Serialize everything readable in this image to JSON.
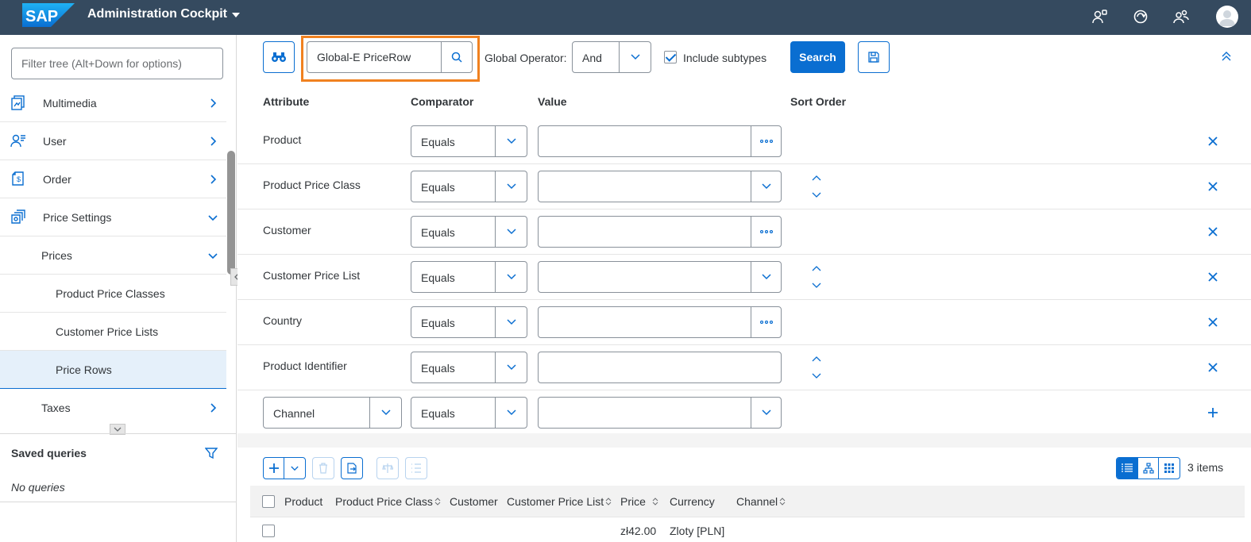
{
  "shell": {
    "logo_text": "SAP",
    "app_title": "Administration Cockpit"
  },
  "left": {
    "filter_placeholder": "Filter tree (Alt+Down for options)",
    "tree": [
      {
        "label": "Multimedia",
        "icon": "multimedia-icon",
        "level": 0,
        "expanded": false
      },
      {
        "label": "User",
        "icon": "user-icon",
        "level": 0,
        "expanded": false
      },
      {
        "label": "Order",
        "icon": "order-icon",
        "level": 0,
        "expanded": false
      },
      {
        "label": "Price Settings",
        "icon": "price-settings-icon",
        "level": 0,
        "expanded": true
      },
      {
        "label": "Prices",
        "level": 1,
        "expanded": true
      },
      {
        "label": "Product Price Classes",
        "level": 2
      },
      {
        "label": "Customer Price Lists",
        "level": 2
      },
      {
        "label": "Price Rows",
        "level": 2,
        "selected": true
      },
      {
        "label": "Taxes",
        "level": 1,
        "expanded": false
      }
    ],
    "saved_queries_title": "Saved queries",
    "no_queries": "No queries"
  },
  "search": {
    "type_value": "Global-E PriceRow",
    "global_operator_label": "Global Operator:",
    "global_operator_value": "And",
    "include_subtypes_label": "Include subtypes",
    "include_subtypes_checked": true,
    "search_label": "Search"
  },
  "criteria": {
    "headers": {
      "attribute": "Attribute",
      "comparator": "Comparator",
      "value": "Value",
      "sort_order": "Sort Order"
    },
    "rows": [
      {
        "attribute": "Product",
        "comparator": "Equals",
        "value_type": "reference",
        "sortable": false,
        "action": "remove"
      },
      {
        "attribute": "Product Price Class",
        "comparator": "Equals",
        "value_type": "dropdown",
        "sortable": true,
        "action": "remove"
      },
      {
        "attribute": "Customer",
        "comparator": "Equals",
        "value_type": "reference",
        "sortable": false,
        "action": "remove"
      },
      {
        "attribute": "Customer Price List",
        "comparator": "Equals",
        "value_type": "dropdown",
        "sortable": true,
        "action": "remove"
      },
      {
        "attribute": "Country",
        "comparator": "Equals",
        "value_type": "reference",
        "sortable": false,
        "action": "remove"
      },
      {
        "attribute": "Product Identifier",
        "comparator": "Equals",
        "value_type": "text",
        "sortable": true,
        "action": "remove"
      },
      {
        "attribute": "Channel",
        "comparator": "Equals",
        "value_type": "dropdown",
        "sortable": false,
        "action": "add",
        "attribute_select": true
      }
    ]
  },
  "results": {
    "items_count": "3 items",
    "columns": [
      "Product",
      "Product Price Class",
      "Customer",
      "Customer Price List",
      "Price",
      "Currency",
      "Channel"
    ],
    "rows": [
      {
        "product": "",
        "price_class": "",
        "customer": "",
        "price_list": "",
        "price": "zł42.00",
        "currency": "Zloty [PLN]",
        "channel": ""
      }
    ]
  },
  "colors": {
    "shell": "#354a5f",
    "accent": "#0a6ed1",
    "highlight": "#f08120",
    "selected_bg": "#e5f0fa"
  }
}
